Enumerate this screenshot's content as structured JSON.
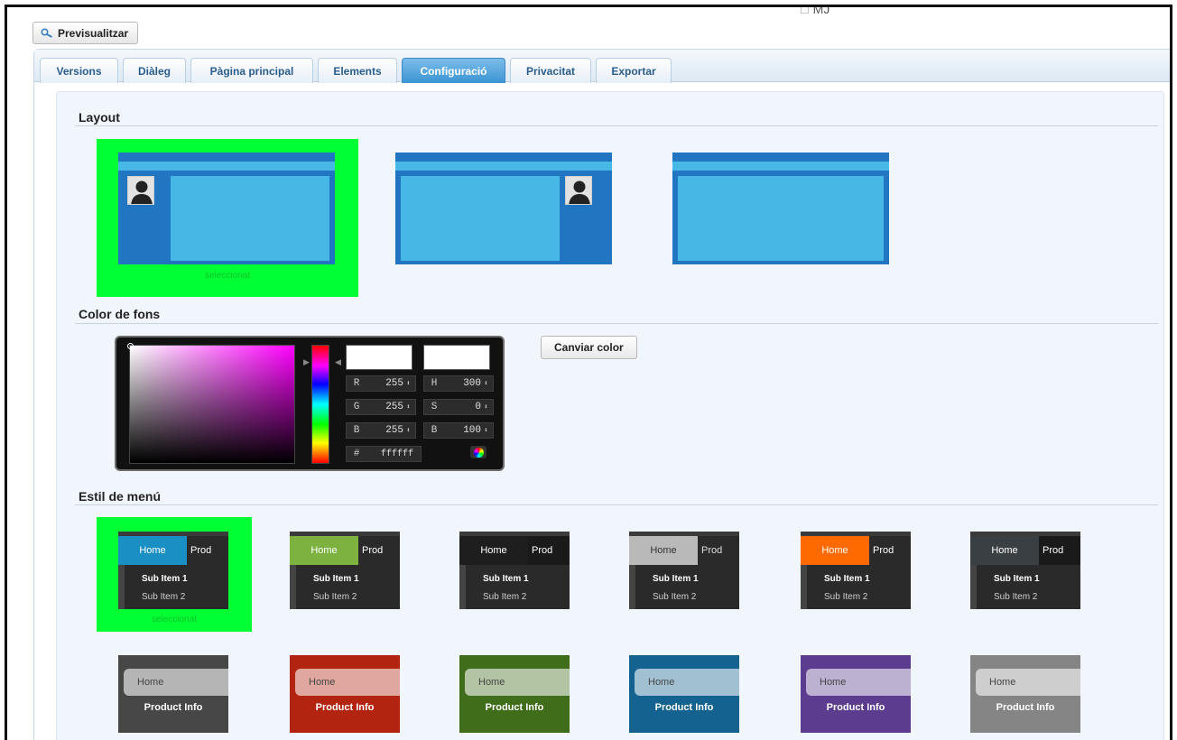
{
  "top_user": {
    "label": "MJ",
    "icon": "user-icon"
  },
  "preview_button": {
    "label": "Previsualitzar",
    "icon": "search-icon"
  },
  "tabs": [
    {
      "label": "Versions",
      "active": false
    },
    {
      "label": "Diàleg",
      "active": false
    },
    {
      "label": "Pàgina principal",
      "active": false
    },
    {
      "label": "Elements",
      "active": false
    },
    {
      "label": "Configuració",
      "active": true
    },
    {
      "label": "Privacitat",
      "active": false
    },
    {
      "label": "Exportar",
      "active": false
    }
  ],
  "layout_section": {
    "title": "Layout",
    "options": [
      {
        "id": "sidebar-left",
        "avatar_side": "left",
        "selected": true
      },
      {
        "id": "sidebar-right",
        "avatar_side": "right",
        "selected": false
      },
      {
        "id": "no-sidebar",
        "avatar_side": "none",
        "selected": false
      }
    ],
    "selected_label": "seleccionat"
  },
  "color_section": {
    "title": "Color de fons",
    "picker": {
      "r_label": "R",
      "r": "255",
      "g_label": "G",
      "g": "255",
      "b_label": "B",
      "b": "255",
      "h_label": "H",
      "h": "300",
      "s_label": "S",
      "s": "0",
      "bright_label": "B",
      "bright": "100",
      "hex_label": "#",
      "hex": "ffffff",
      "spin_glyph": "⬍"
    },
    "change_button": "Canviar color"
  },
  "menu_section": {
    "title": "Estil de menú",
    "selected_label": "seleccionat",
    "row1": [
      {
        "home": "Home",
        "prod": "Prod",
        "sub1": "Sub Item 1",
        "sub2": "Sub Item 2",
        "accent": "#1a8fc4",
        "selected": true
      },
      {
        "home": "Home",
        "prod": "Prod",
        "sub1": "Sub Item 1",
        "sub2": "Sub Item 2",
        "accent": "#7db240",
        "selected": false
      },
      {
        "home": "Home",
        "prod": "Prod",
        "sub1": "Sub Item 1",
        "sub2": "Sub Item 2",
        "accent": "#1e1e1e",
        "selected": false
      },
      {
        "home": "Home",
        "prod": "Prod",
        "sub1": "Sub Item 1",
        "sub2": "Sub Item 2",
        "accent": "#b9b9b9",
        "selected": false
      },
      {
        "home": "Home",
        "prod": "Prod",
        "sub1": "Sub Item 1",
        "sub2": "Sub Item 2",
        "accent": "#ff6a00",
        "selected": false
      },
      {
        "home": "Home",
        "prod": "Prod",
        "sub1": "Sub Item 1",
        "sub2": "Sub Item 2",
        "accent": "#3a3f44",
        "selected": false
      }
    ],
    "row2": [
      {
        "home": "Home",
        "product": "Product Info",
        "color": "#474747"
      },
      {
        "home": "Home",
        "product": "Product Info",
        "color": "#b22410"
      },
      {
        "home": "Home",
        "product": "Product Info",
        "color": "#3f6d1a"
      },
      {
        "home": "Home",
        "product": "Product Info",
        "color": "#14628f"
      },
      {
        "home": "Home",
        "product": "Product Info",
        "color": "#5b3c8e"
      },
      {
        "home": "Home",
        "product": "Product Info",
        "color": "#858585"
      }
    ]
  }
}
